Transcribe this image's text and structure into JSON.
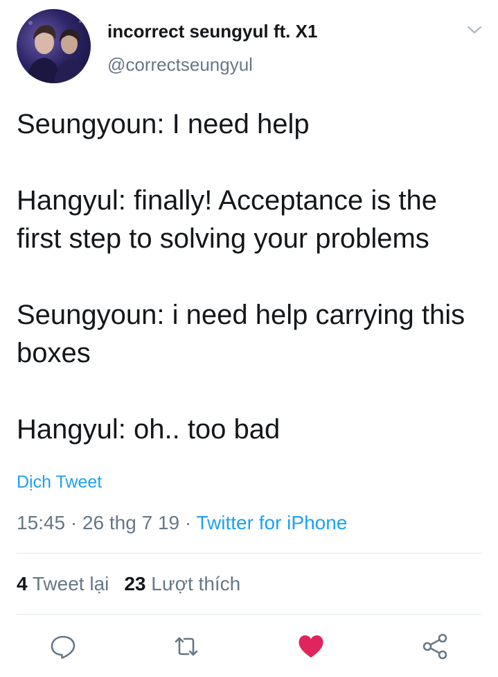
{
  "tweet": {
    "display_name": "incorrect seungyul ft. X1",
    "handle": "@correctseungyul",
    "avatar_icon": "profile-photo",
    "body": [
      "Seungyoun: I need help",
      "Hangyul: finally! Acceptance is the first step to solving your problems",
      "Seungyoun: i need help carrying this boxes",
      "Hangyul: oh.. too bad"
    ],
    "translate_label": "Dịch Tweet",
    "time": "15:45",
    "sep1": " · ",
    "date": "26 thg 7 19",
    "sep2": " · ",
    "source": "Twitter for iPhone",
    "retweet_count": "4",
    "retweet_label": "Tweet lại",
    "like_count": "23",
    "like_label": "Lượt thích"
  },
  "actions": {
    "reply_icon": "reply-icon",
    "retweet_icon": "retweet-icon",
    "like_icon": "heart-icon",
    "share_icon": "share-icon"
  },
  "colors": {
    "accent": "#1da1f2",
    "muted": "#657786",
    "text": "#14171a",
    "like": "#e0245e",
    "divider": "#e1e8ed"
  }
}
